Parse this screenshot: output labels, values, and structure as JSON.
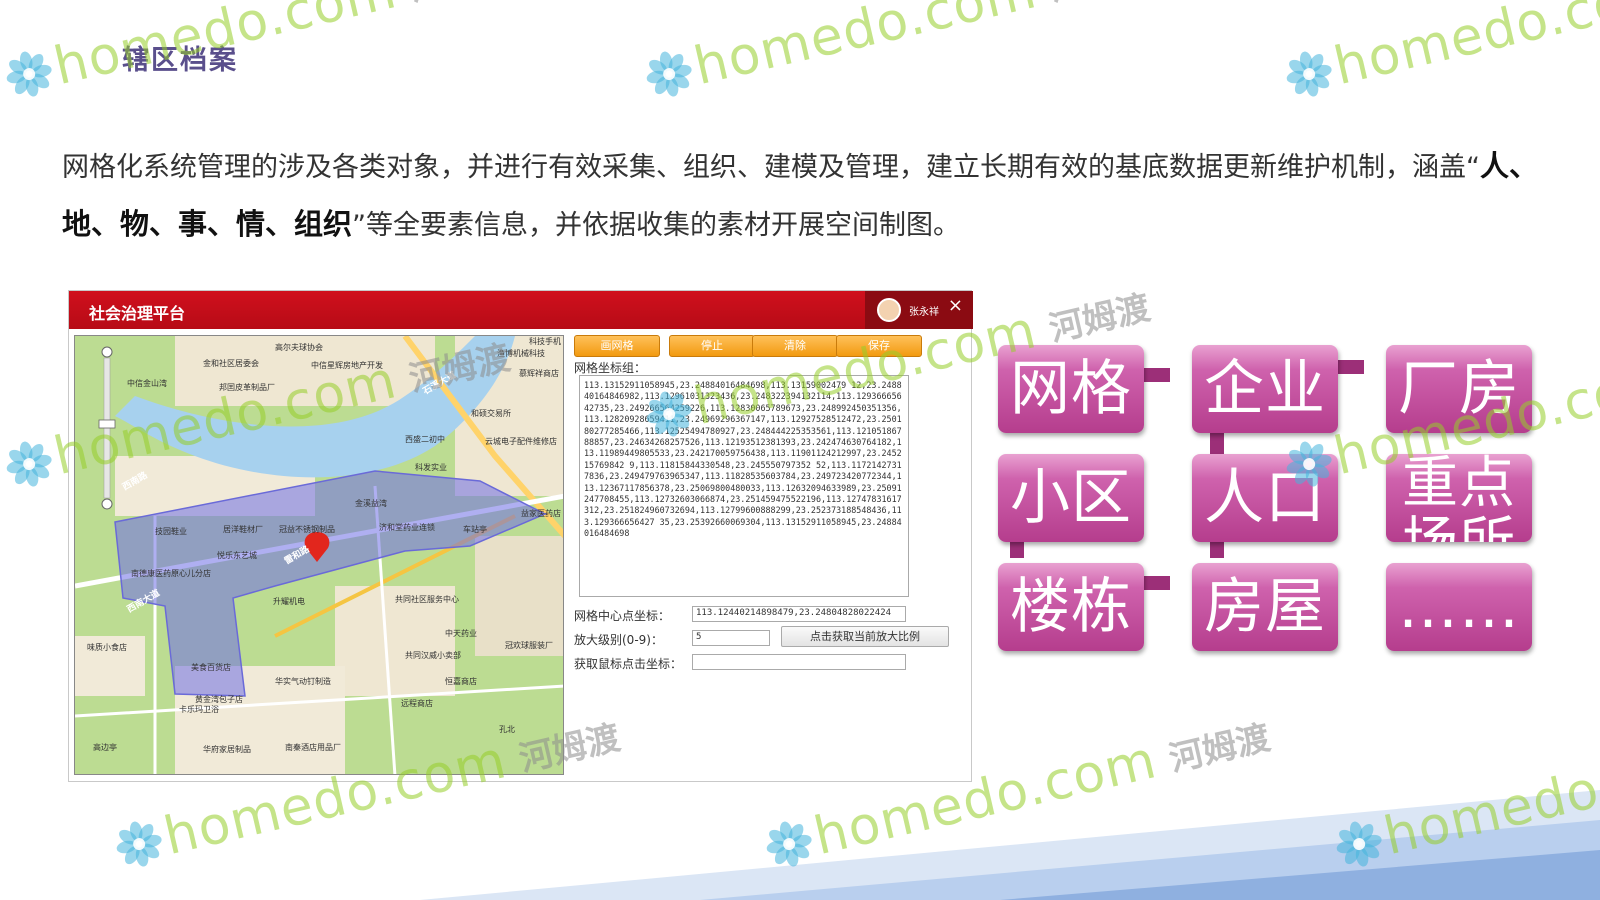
{
  "slide": {
    "title": "辖区档案",
    "intro_before": "网格化系统管理的涉及各类对象，并进行有效采集、组织、建模及管理，建立长期有效的基底数据更新维护机制，涵盖“",
    "intro_bold": "人、地、物、事、情、组织",
    "intro_after": "”等全要素信息，并依据收集的素材开展空间制图。"
  },
  "watermark": {
    "en": "homedo.com",
    "cn": "河姆渡"
  },
  "app": {
    "title": "社会治理平台",
    "user_name": "张永祥",
    "close_symbol": "×",
    "buttons": [
      "画网格",
      "停止",
      "清除",
      "保存"
    ],
    "grid_coords_label": "网格坐标组：",
    "grid_coords": "113.13152911058945,23.24884016484698,113.13159002479 12,23.248840164846982,113.12961031323436,23.248322394132114,113.12936665642735,23.249266564259226,113.12830065789673,23.248992450351356,113.12820928659411,23.24969296367147,113.12927528512472,23.250180277285466,113.12525494780927,23.248444225353561,113.12105186788857,23.24634268257526,113.12193512381393,23.242474630764182,113.11989449805533,23.242170059756438,113.11901124212997,23.245215769842 9,113.11815844330548,23.245550797352 52,113.11721427317836,23.249479763965347,113.11828535603784,23.249723420772344,113.12367117856378,23.25069800480033,113.12632094633989,23.25091247708455,113.12732603066874,23.251459475522196,113.12747831617312,23.251824960732694,113.12799600888299,23.252373188548436,113.129366656427 35,23.25392660069304,113.13152911058945,23.24884016484698",
    "center_label": "网格中心点坐标：",
    "center_value": "113.12440214898479,23.24804828022424",
    "zoom_label": "放大级别(0-9)：",
    "zoom_value": "5",
    "get_zoom_button": "点击获取当前放大比例",
    "click_coord_label": "获取鼠标点击坐标：",
    "click_coord_value": ""
  },
  "map_labels": [
    "高尔夫球协会",
    "金和社区居委会",
    "中信星辉房地产开发",
    "中信金山湾",
    "邦囯皮革制品厂",
    "科技手机",
    "渔博机械科技",
    "慕辉祥商店",
    "和硕交易所",
    "西盛二初中",
    "云城电子配件维修店",
    "科发实业",
    "益家医药店",
    "金溪益湾",
    "技园鞋业",
    "居洋鞋材厂",
    "冠益不锈钢制品",
    "济和堂药业连锁",
    "车站亭",
    "悦乐东艺城",
    "南德康医药原心儿分店",
    "升耀机电",
    "共同社区服务中心",
    "中天药业",
    "冠欢球服装厂",
    "味质小食店",
    "美食百货店",
    "共同汉威小卖部",
    "恒嘉商店",
    "华实气动钉制造",
    "远程商店",
    "黄金湾包子店",
    "卡乐玛卫浴",
    "高边亭",
    "华府家居制品",
    "孔北",
    "南秦酒店用品厂",
    "石溪大道",
    "雷和路",
    "西南路",
    "西南大道"
  ],
  "tiles": [
    "网格",
    "企业",
    "厂房",
    "小区",
    "人口",
    "重点场所",
    "楼栋",
    "房屋",
    "……"
  ],
  "colors": {
    "accent_red": "#c20d19",
    "tile_pink": "#c8529f",
    "title_purple": "#5a4f8c",
    "band_blue": "#a9c3e8",
    "button_orange": "#f29a10"
  }
}
